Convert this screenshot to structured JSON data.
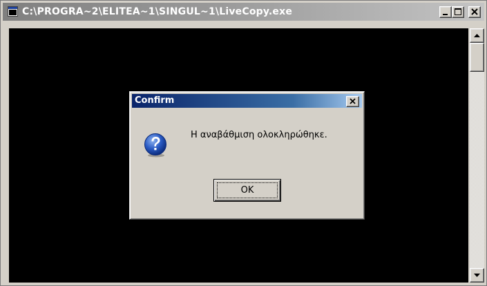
{
  "window": {
    "title": "C:\\PROGRA~2\\ELITEA~1\\SINGUL~1\\LiveCopy.exe",
    "icon": "console-app-icon",
    "controls": [
      "minimize-icon",
      "maximize-icon",
      "close-icon"
    ],
    "titlebar_colors": [
      "#808080",
      "#c4c4c4"
    ]
  },
  "console": {
    "background": "#000000"
  },
  "dialog": {
    "title": "Confirm",
    "message": "Η αναβάθμιση ολοκληρώθηκε.",
    "icon": "question-icon",
    "ok_label": "OK",
    "titlebar_colors": [
      "#0a246a",
      "#a6caf0"
    ]
  },
  "scrollbar": {
    "up_icon": "arrow-up-icon",
    "down_icon": "arrow-down-icon"
  }
}
